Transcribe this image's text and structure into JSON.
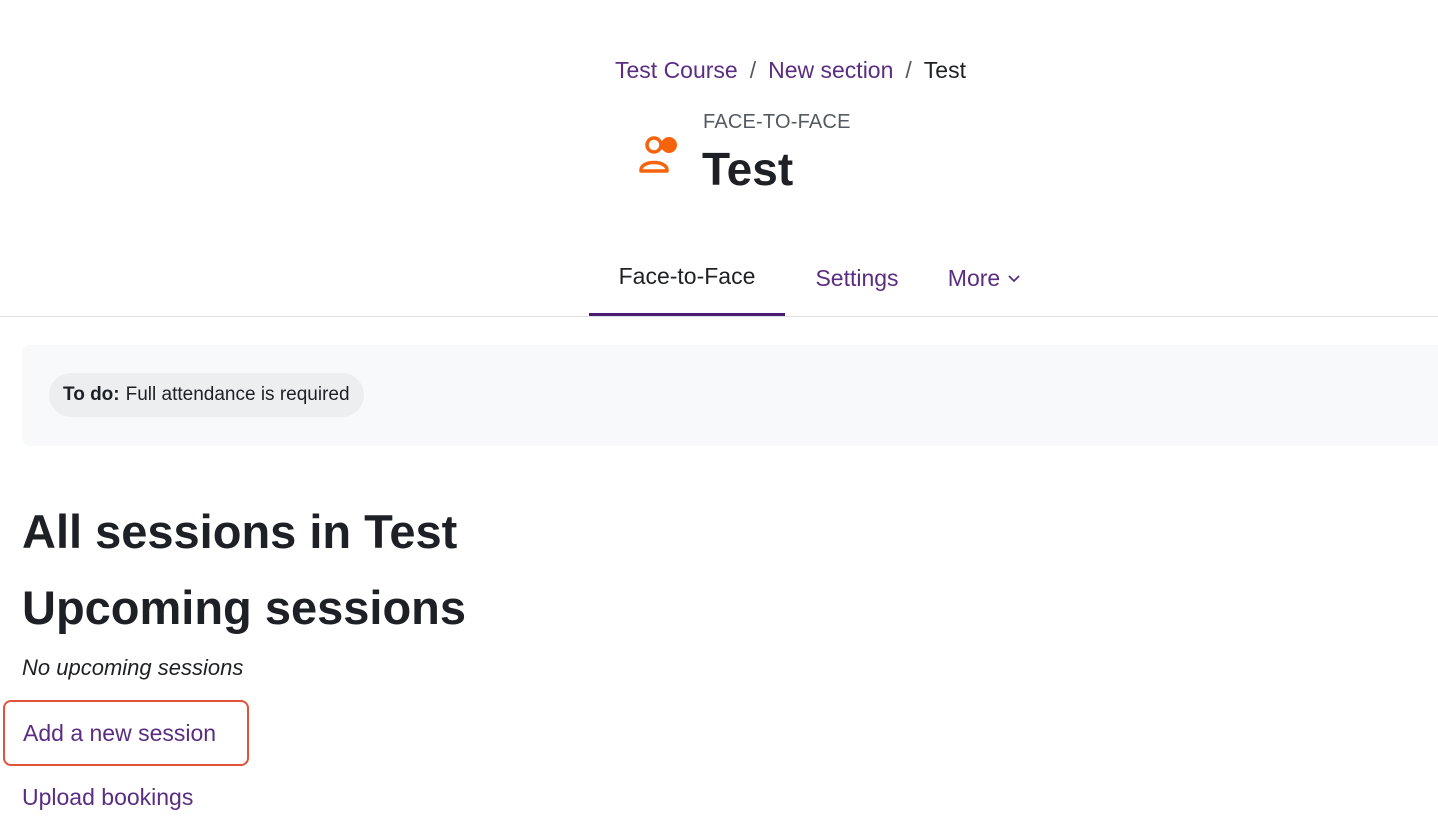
{
  "breadcrumb": {
    "items": [
      "Test Course",
      "New section",
      "Test"
    ],
    "separator": "/"
  },
  "header": {
    "module_type": "FACE-TO-FACE",
    "title": "Test",
    "icon": "face-to-face-people-icon",
    "icon_color": "#f7630c"
  },
  "tabs": [
    {
      "label": "Face-to-Face",
      "active": true
    },
    {
      "label": "Settings",
      "active": false
    },
    {
      "label": "More",
      "active": false,
      "icon": "chevron-down-icon"
    }
  ],
  "completion": {
    "label": "To do:",
    "text": "Full attendance is required"
  },
  "main": {
    "heading_all": "All sessions in Test",
    "heading_upcoming": "Upcoming sessions",
    "no_upcoming": "No upcoming sessions",
    "add_session": "Add a new session",
    "upload_bookings": "Upload bookings"
  },
  "colors": {
    "link": "#5a2d82",
    "active_tab_underline": "#4a1d73",
    "highlight_border": "#e0533a",
    "text": "#1d2125"
  }
}
